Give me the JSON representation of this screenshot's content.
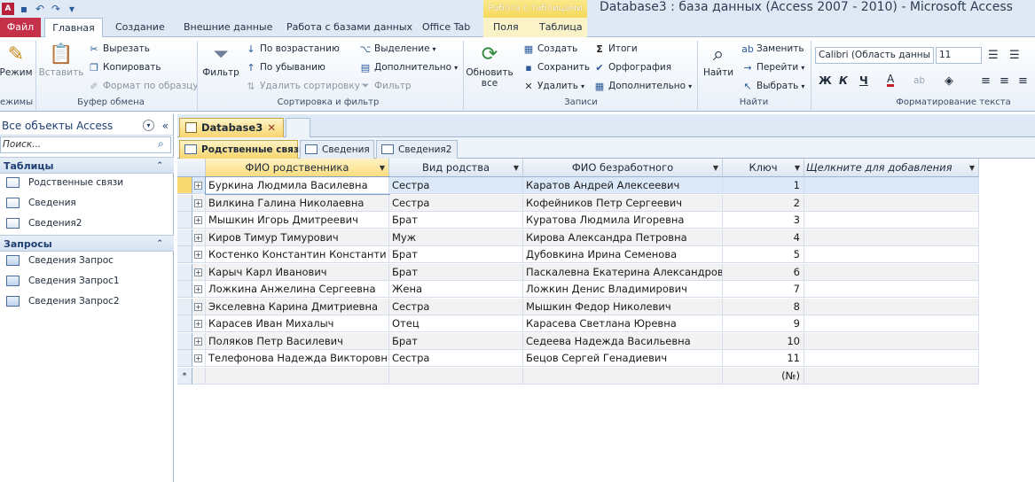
{
  "titlebar": {
    "context_tools": "Работа с таблицами",
    "window_title": "Database3 : база данных (Access 2007 - 2010)  -  Microsoft Access"
  },
  "ribbon_tabs": {
    "file": "Файл",
    "home": "Главная",
    "create": "Создание",
    "external": "Внешние данные",
    "database": "Работа с базами данных",
    "officetab": "Office Tab",
    "fields": "Поля",
    "table": "Таблица"
  },
  "ribbon": {
    "views": {
      "mode": "Режим",
      "label": "ежимы"
    },
    "clipboard": {
      "paste": "Вставить",
      "cut": "Вырезать",
      "copy": "Копировать",
      "format_painter": "Формат по образцу",
      "label": "Буфер обмена"
    },
    "sort_filter": {
      "filter": "Фильтр",
      "ascending": "По возрастанию",
      "descending": "По убыванию",
      "remove_sort": "Удалить сортировку",
      "selection": "Выделение",
      "advanced": "Дополнительно",
      "toggle_filter": "Фильтр",
      "label": "Сортировка и фильтр"
    },
    "records": {
      "refresh": "Обновить",
      "refresh2": "все",
      "new": "Создать",
      "save": "Сохранить",
      "delete": "Удалить",
      "totals": "Итоги",
      "spelling": "Орфография",
      "more": "Дополнительно",
      "label": "Записи"
    },
    "find": {
      "find": "Найти",
      "replace": "Заменить",
      "goto": "Перейти",
      "select": "Выбрать",
      "label": "Найти"
    },
    "text_format": {
      "font": "Calibri (Область данны",
      "size": "11",
      "bold": "Ж",
      "italic": "К",
      "underline": "Ч",
      "font_color": "А",
      "label": "Форматирование текста"
    }
  },
  "nav": {
    "header": "Все объекты Access",
    "search_placeholder": "Поиск...",
    "tables_label": "Таблицы",
    "tables": [
      "Родственные связи",
      "Сведения",
      "Сведения2"
    ],
    "queries_label": "Запросы",
    "queries": [
      "Сведения Запрос",
      "Сведения Запрос1",
      "Сведения Запрос2"
    ]
  },
  "doc_tab": "Database3",
  "object_tabs": [
    "Родственные связи",
    "Сведения",
    "Сведения2"
  ],
  "grid": {
    "columns": [
      "ФИО родственника",
      "Вид родства",
      "ФИО безработного",
      "Ключ",
      "Щелкните для добавления"
    ],
    "rows": [
      [
        "Буркина Людмила Василевна",
        "Сестра",
        "Каратов Андрей Алексеевич",
        "1"
      ],
      [
        "Вилкина Галина Николаевна",
        "Сестра",
        "Кофейников Петр Сергеевич",
        "2"
      ],
      [
        "Мышкин Игорь Дмитреевич",
        "Брат",
        "Куратова Людмила Игоревна",
        "3"
      ],
      [
        "Киров Тимур Тимурович",
        "Муж",
        "Кирова Александра Петровна",
        "4"
      ],
      [
        "Костенко Константин  Константи",
        "Брат",
        "Дубовкина Ирина Семенова",
        "5"
      ],
      [
        "Карыч Карл Иванович",
        "Брат",
        "Паскалевна Екатерина Александров",
        "6"
      ],
      [
        "Ложкина  Анжелина Сергеевна",
        "Жена",
        "Ложкин Денис Владимирович",
        "7"
      ],
      [
        "Экселевна Карина Дмитриевна",
        "Сестра",
        "Мышкин Федор Николевич",
        "8"
      ],
      [
        "Карасев Иван Михалыч",
        "Отец",
        "Карасева Светлана Юревна",
        "9"
      ],
      [
        "Поляков Петр Василевич",
        "Брат",
        "Седеева Надежда Васильевна",
        "10"
      ],
      [
        "Телефонова Надежда Викторовн",
        "Сестра",
        "Бецов Сергей Генадиевич",
        "11"
      ]
    ],
    "new_row_marker": "*",
    "new_row_key": "(№)"
  }
}
